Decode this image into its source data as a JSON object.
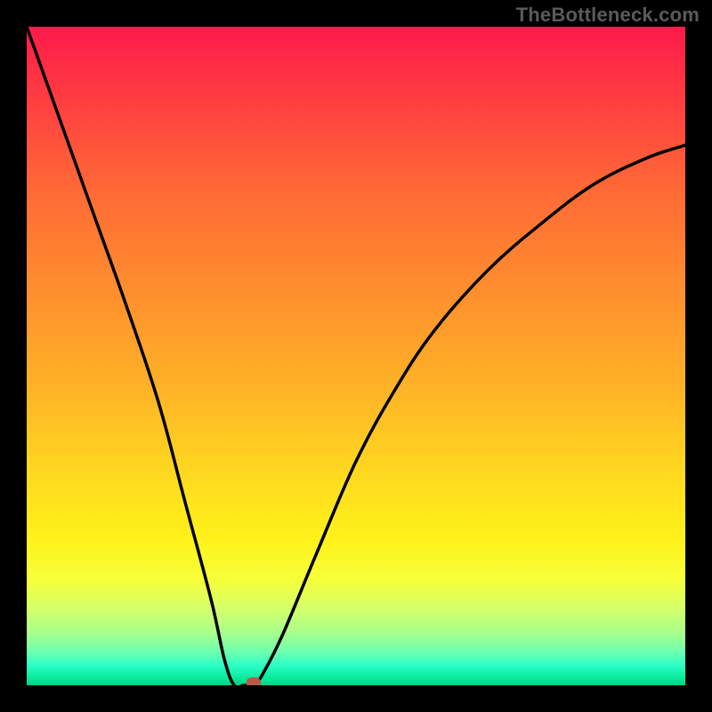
{
  "watermark": "TheBottleneck.com",
  "colors": {
    "background": "#000000",
    "gradient_top": "#ff1a4b",
    "gradient_bottom": "#00d084",
    "curve": "#000000",
    "marker": "#b85a4a",
    "watermark_text": "#5a5a5a"
  },
  "chart_data": {
    "type": "line",
    "title": "",
    "xlabel": "",
    "ylabel": "",
    "xlim": [
      0,
      1
    ],
    "ylim": [
      0,
      1
    ],
    "series": [
      {
        "name": "curve",
        "x": [
          0.0,
          0.05,
          0.1,
          0.15,
          0.2,
          0.24,
          0.28,
          0.3,
          0.315,
          0.33,
          0.345,
          0.36,
          0.39,
          0.44,
          0.5,
          0.56,
          0.62,
          0.7,
          0.78,
          0.86,
          0.94,
          1.0
        ],
        "y": [
          1.0,
          0.86,
          0.72,
          0.58,
          0.43,
          0.28,
          0.13,
          0.04,
          0.0,
          0.0,
          0.0,
          0.02,
          0.08,
          0.2,
          0.34,
          0.45,
          0.54,
          0.63,
          0.7,
          0.76,
          0.8,
          0.82
        ]
      }
    ],
    "annotations": [
      {
        "name": "marker",
        "x": 0.345,
        "y": 0.0
      }
    ],
    "background_gradient": {
      "direction": "vertical",
      "stops": [
        {
          "pos": 0.0,
          "color": "#ff1a4b"
        },
        {
          "pos": 0.25,
          "color": "#ff6a36"
        },
        {
          "pos": 0.55,
          "color": "#ffb326"
        },
        {
          "pos": 0.78,
          "color": "#fff21a"
        },
        {
          "pos": 0.95,
          "color": "#6cffb0"
        },
        {
          "pos": 1.0,
          "color": "#00d084"
        }
      ]
    }
  }
}
